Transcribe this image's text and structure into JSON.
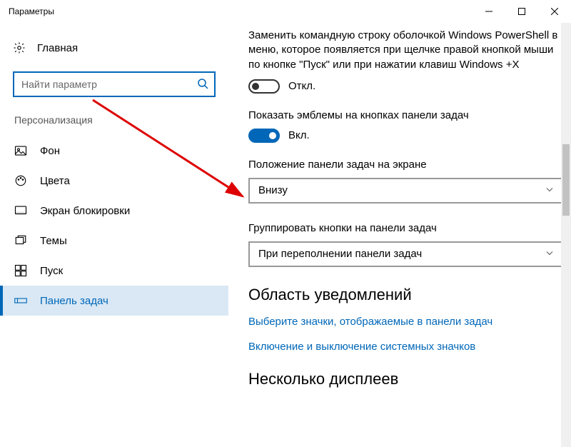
{
  "window": {
    "title": "Параметры"
  },
  "sidebar": {
    "home": "Главная",
    "search_placeholder": "Найти параметр",
    "category": "Персонализация",
    "items": [
      {
        "label": "Фон"
      },
      {
        "label": "Цвета"
      },
      {
        "label": "Экран блокировки"
      },
      {
        "label": "Темы"
      },
      {
        "label": "Пуск"
      },
      {
        "label": "Панель задач"
      }
    ]
  },
  "main": {
    "powershell_text": "Заменить командную строку оболочкой Windows PowerShell в меню, которое появляется при щелчке правой кнопкой мыши по кнопке \"Пуск\" или при нажатии клавиш Windows +X",
    "powershell_state": "Откл.",
    "badges_text": "Показать эмблемы на кнопках панели задач",
    "badges_state": "Вкл.",
    "position_label": "Положение панели задач на экране",
    "position_value": "Внизу",
    "combine_label": "Группировать кнопки на панели задач",
    "combine_value": "При переполнении панели задач",
    "section_notification": "Область уведомлений",
    "link_icons": "Выберите значки, отображаемые в панели задач",
    "link_system_icons": "Включение и выключение системных значков",
    "section_displays": "Несколько дисплеев"
  }
}
